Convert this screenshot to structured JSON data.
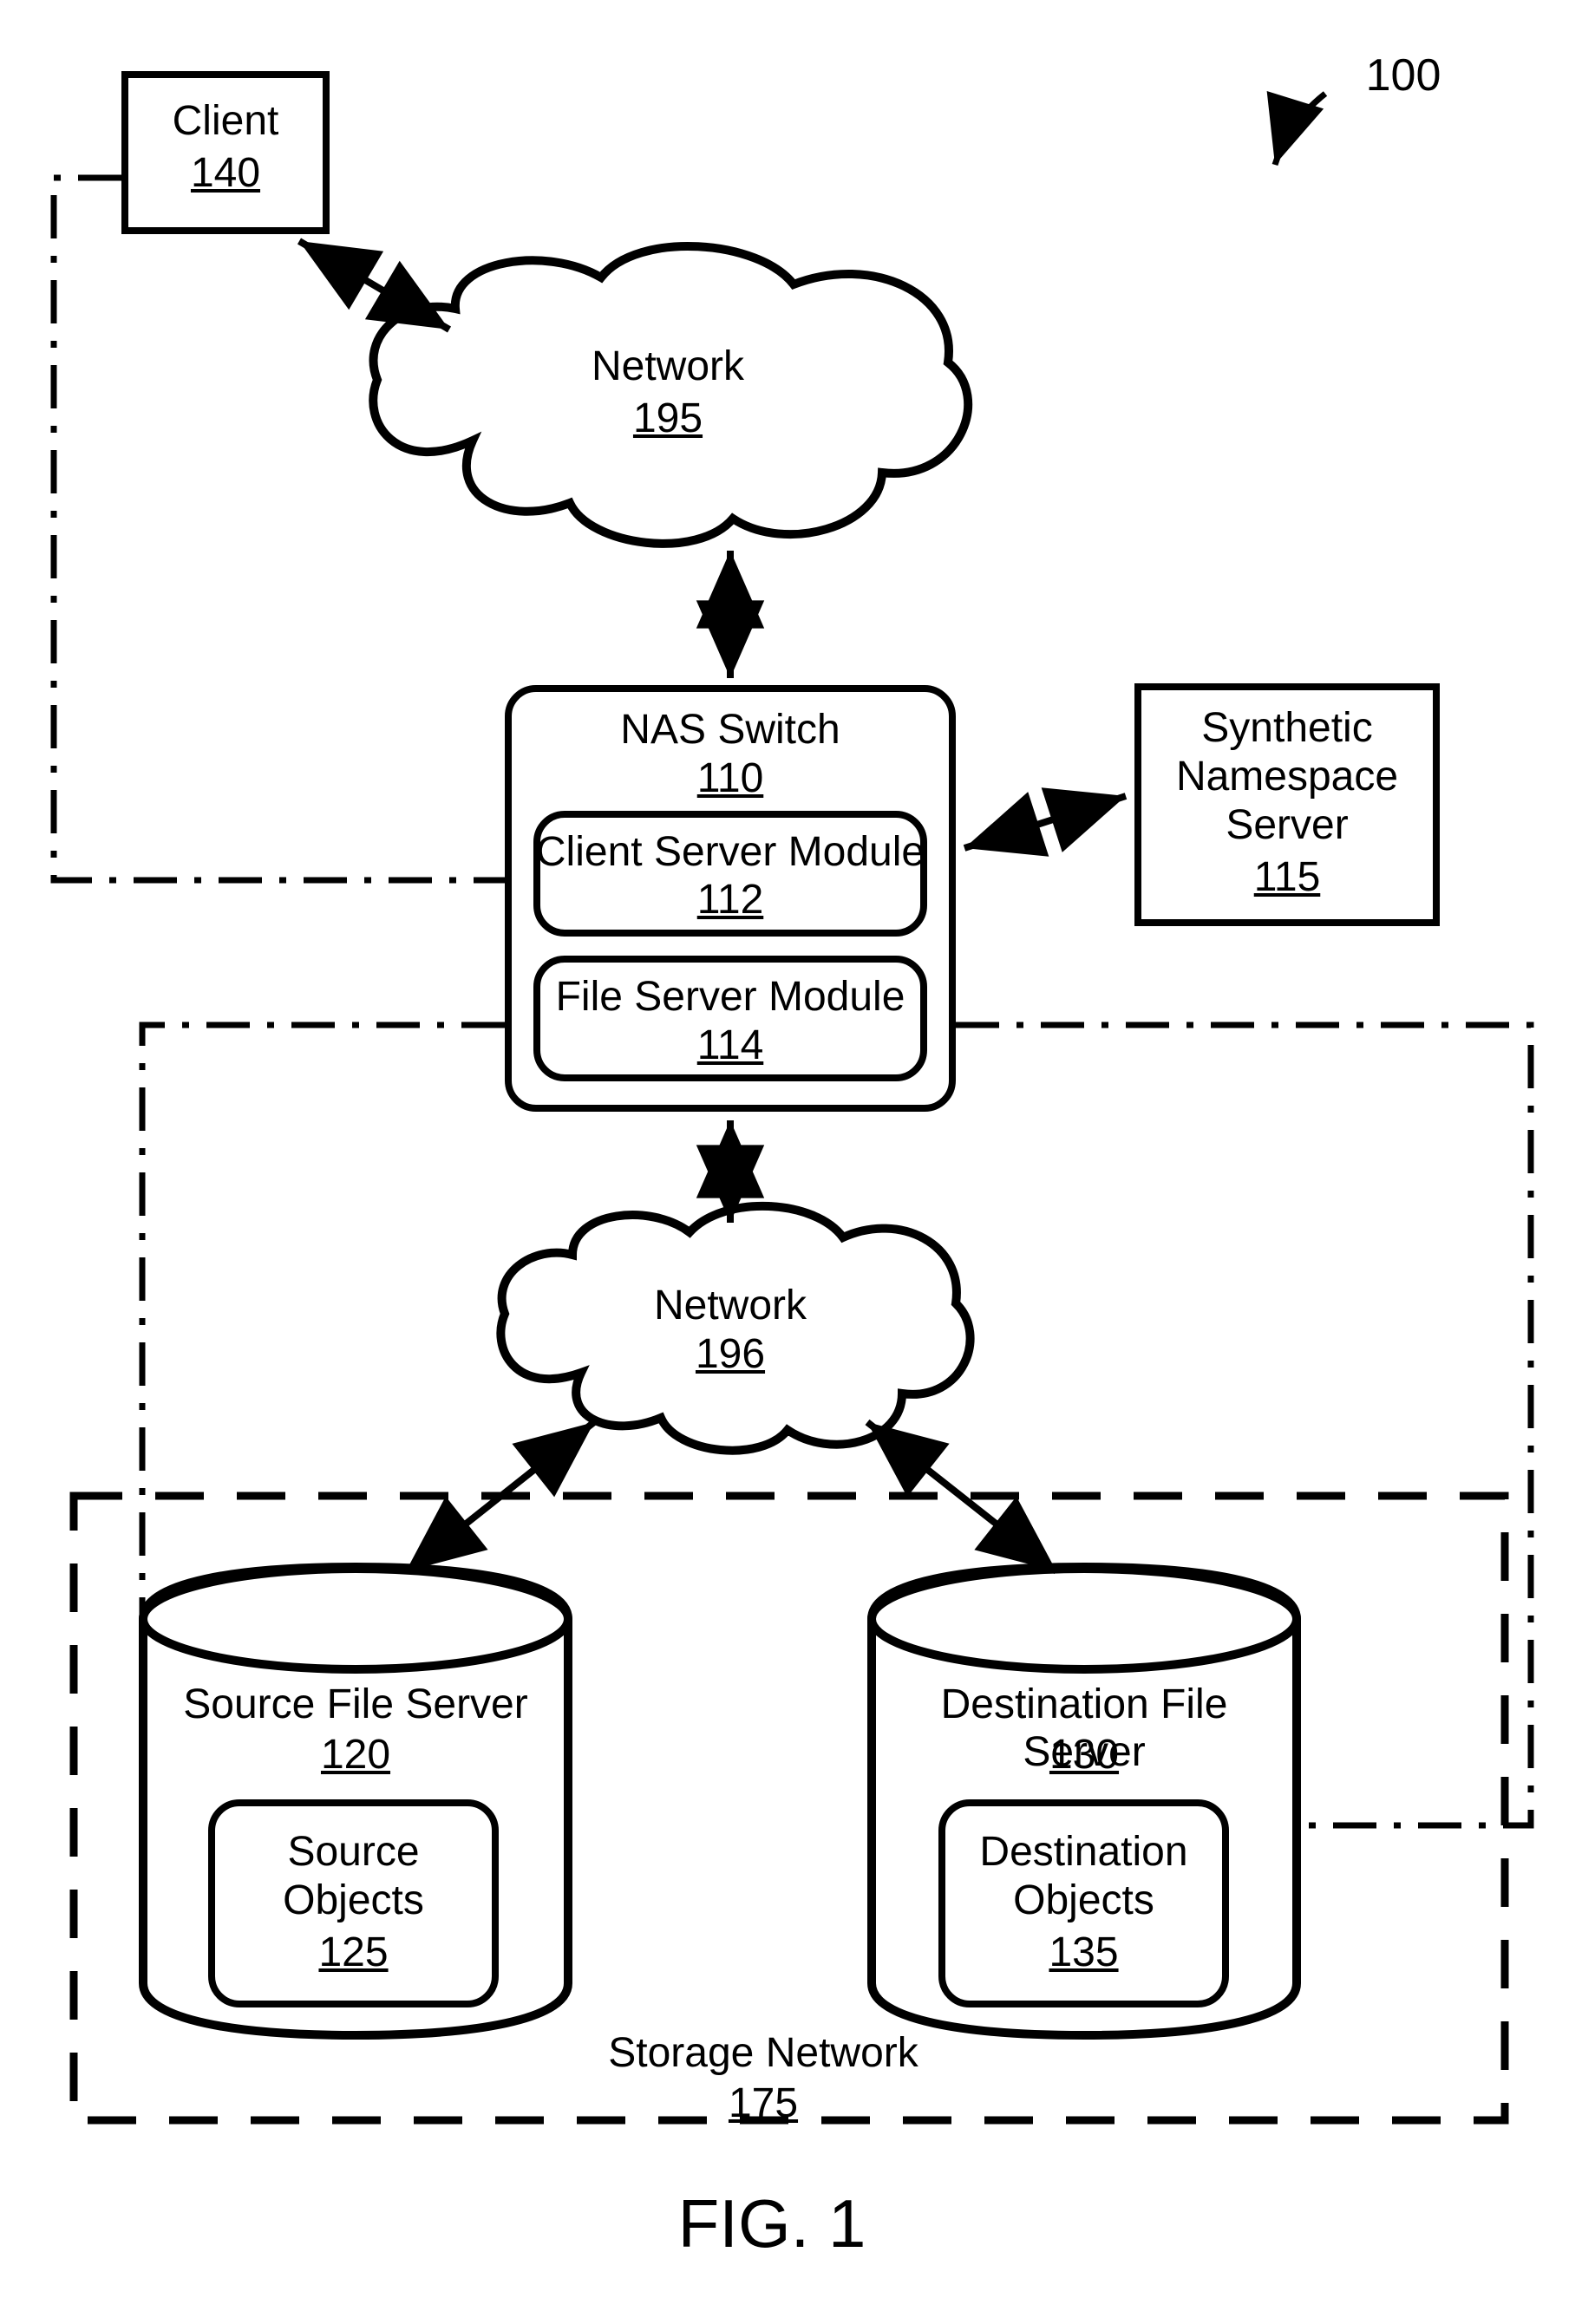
{
  "figure": {
    "title": "FIG. 1",
    "diagram_ref": "100"
  },
  "nodes": {
    "client": {
      "label": "Client",
      "ref": "140"
    },
    "network_top": {
      "label": "Network",
      "ref": "195"
    },
    "nas_switch": {
      "label": "NAS Switch",
      "ref": "110",
      "modules": {
        "client_server": {
          "label": "Client Server Module",
          "ref": "112"
        },
        "file_server": {
          "label": "File Server Module",
          "ref": "114"
        }
      }
    },
    "synth_ns": {
      "label": "Synthetic Namespace Server",
      "ref": "115"
    },
    "network_mid": {
      "label": "Network",
      "ref": "196"
    },
    "src_server": {
      "label": "Source File Server",
      "ref": "120",
      "objects": {
        "label": "Source Objects",
        "ref": "125"
      }
    },
    "dst_server": {
      "label": "Destination File Server",
      "ref": "130",
      "objects": {
        "label": "Destination Objects",
        "ref": "135"
      }
    },
    "storage_net": {
      "label": "Storage Network",
      "ref": "175"
    }
  }
}
